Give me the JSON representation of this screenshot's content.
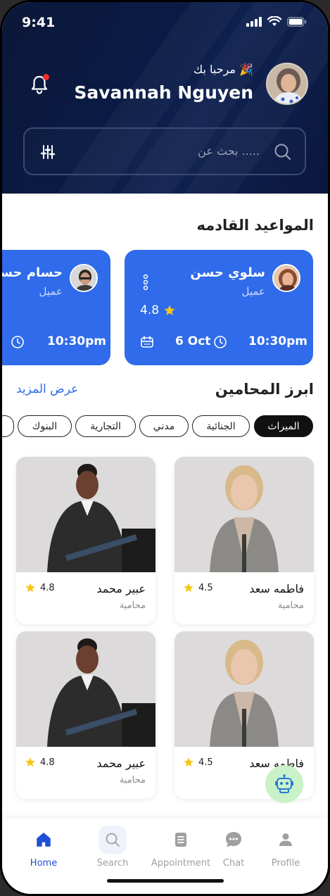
{
  "status_bar": {
    "time": "9:41"
  },
  "header": {
    "greeting": "مرحبا بك",
    "greeting_emoji": "🎉",
    "user_name": "Savannah Nguyen"
  },
  "search": {
    "placeholder": "بحث عن ....."
  },
  "upcoming": {
    "title": "المواعيد القادمه",
    "appointments": [
      {
        "name": "سلوي حسن",
        "role": "عميل",
        "rating": "4.8",
        "date": "6 Oct",
        "time": "10:30pm"
      },
      {
        "name": "حسام حسن",
        "role": "عميل",
        "time": "10:30pm"
      }
    ]
  },
  "lawyers": {
    "title": "ابرز المحامين",
    "see_more": "عرض المزيد",
    "categories": [
      "الميراث",
      "الجنائية",
      "مدني",
      "التجارية",
      "البنوك"
    ],
    "active_category": "الميراث",
    "cards": [
      {
        "name": "فاطمه سعد",
        "role": "محامية",
        "rating": "4.5"
      },
      {
        "name": "عبير محمد",
        "role": "محامية",
        "rating": "4.8"
      },
      {
        "name": "فاطمه سعد",
        "role": "",
        "rating": "4.5"
      },
      {
        "name": "عبير محمد",
        "role": "محامية",
        "rating": "4.8"
      }
    ]
  },
  "bottom_nav": [
    {
      "label": "Home",
      "icon": "home-icon",
      "active": true
    },
    {
      "label": "Search",
      "icon": "search-icon"
    },
    {
      "label": "Appointment",
      "icon": "document-icon"
    },
    {
      "label": "Chat",
      "icon": "chat-bubble-icon"
    },
    {
      "label": "Profile",
      "icon": "person-icon"
    }
  ],
  "colors": {
    "header_bg": "#0c1838",
    "accent_blue": "#2f6bea",
    "star": "#f5c518",
    "nav_active": "#1f4fd6",
    "bot_fab": "#c9f2c9"
  }
}
